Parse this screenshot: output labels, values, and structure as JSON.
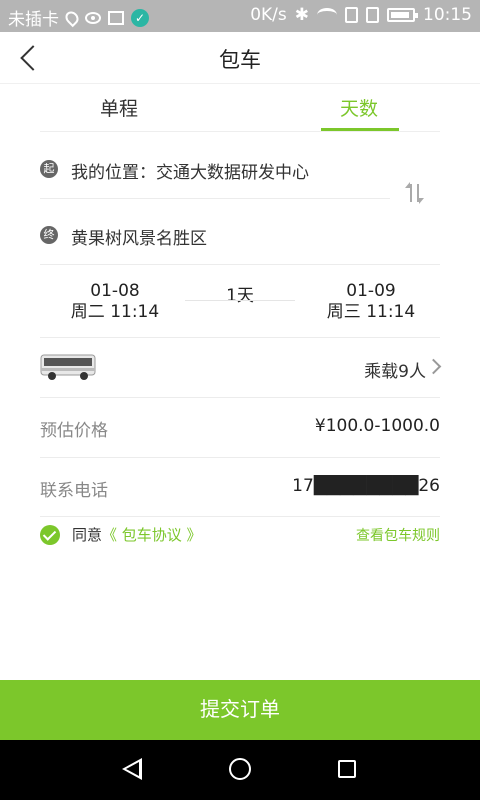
{
  "status_bar": {
    "carrier": "未插卡",
    "net_speed": "0K/s",
    "time": "10:15"
  },
  "header": {
    "title": "包车"
  },
  "tabs": [
    {
      "label": "单程",
      "active": false
    },
    {
      "label": "天数",
      "active": true
    }
  ],
  "route": {
    "start_marker": "起",
    "start_text": "我的位置：交通大数据研发中心",
    "end_marker": "终",
    "end_text": "黄果树风景名胜区"
  },
  "schedule": {
    "start_date": "01-08",
    "start_weekday_time": "周二 11:14",
    "duration": "1天",
    "end_date": "01-09",
    "end_weekday_time": "周三 11:14"
  },
  "vehicle": {
    "capacity": "乘载9人"
  },
  "price": {
    "label": "预估价格",
    "value": "¥100.0-1000.0"
  },
  "phone": {
    "label": "联系电话",
    "value": "17████████26"
  },
  "agreement": {
    "prefix": "同意",
    "link": "《 包车协议 》",
    "rules_link": "查看包车规则"
  },
  "submit_label": "提交订单",
  "colors": {
    "accent": "#7cc72b",
    "statusbar": "#b5b5b5",
    "navbar": "#000000"
  }
}
